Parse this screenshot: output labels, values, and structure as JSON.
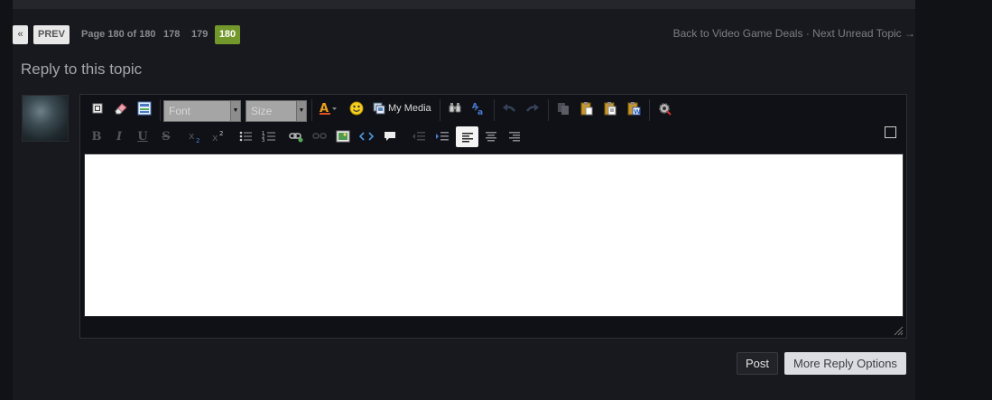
{
  "pagination": {
    "first_label": "«",
    "prev_label": "PREV",
    "page_info": "Page 180 of 180",
    "pages": [
      "178",
      "179"
    ],
    "current_page": "180"
  },
  "top_links": {
    "back_label": "Back to Video Game Deals",
    "separator": "·",
    "next_label": "Next Unread Topic →"
  },
  "reply": {
    "title": "Reply to this topic"
  },
  "editor": {
    "font_label": "Font",
    "size_label": "Size",
    "my_media_label": "My Media",
    "text_value": ""
  },
  "actions": {
    "post_label": "Post",
    "more_label": "More Reply Options"
  },
  "colors": {
    "accent_green": "#72982c",
    "background": "#18191e"
  }
}
